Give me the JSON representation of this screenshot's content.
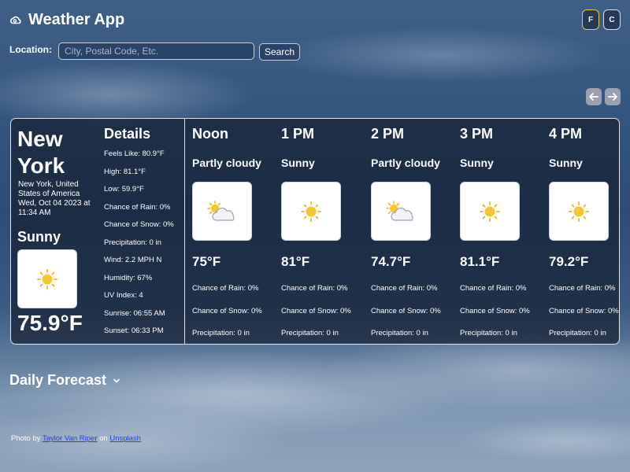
{
  "app": {
    "title": "Weather App"
  },
  "units": {
    "fahrenheit": "F",
    "celsius": "C",
    "selected": "F"
  },
  "search": {
    "label": "Location:",
    "placeholder": "City, Postal Code, Etc.",
    "value": "",
    "button": "Search"
  },
  "current": {
    "city": "New York",
    "location": "New York, United States of America",
    "datetime": "Wed, Oct 04 2023 at 11:34 AM",
    "condition": "Sunny",
    "icon": "sun-icon",
    "temperature": "75.9°F"
  },
  "details": {
    "title": "Details",
    "items": [
      "Feels Like: 80.9°F",
      "High: 81.1°F",
      "Low: 59.9°F",
      "Chance of Rain: 0%",
      "Chance of Snow: 0%",
      "Precipitation: 0 in",
      "Wind: 2.2 MPH N",
      "Humidity: 67%",
      "UV Index: 4",
      "Sunrise: 06:55 AM",
      "Sunset: 06:33 PM"
    ]
  },
  "hourly": [
    {
      "time": "Noon",
      "condition": "Partly cloudy",
      "icon": "partly-cloudy-icon",
      "temp": "75°F",
      "rain": "Chance of Rain: 0%",
      "snow": "Chance of Snow: 0%",
      "precip": "Precipitation: 0 in"
    },
    {
      "time": "1 PM",
      "condition": "Sunny",
      "icon": "sun-icon",
      "temp": "81°F",
      "rain": "Chance of Rain: 0%",
      "snow": "Chance of Snow: 0%",
      "precip": "Precipitation: 0 in"
    },
    {
      "time": "2 PM",
      "condition": "Partly cloudy",
      "icon": "partly-cloudy-icon",
      "temp": "74.7°F",
      "rain": "Chance of Rain: 0%",
      "snow": "Chance of Snow: 0%",
      "precip": "Precipitation: 0 in"
    },
    {
      "time": "3 PM",
      "condition": "Sunny",
      "icon": "sun-icon",
      "temp": "81.1°F",
      "rain": "Chance of Rain: 0%",
      "snow": "Chance of Snow: 0%",
      "precip": "Precipitation: 0 in"
    },
    {
      "time": "4 PM",
      "condition": "Sunny",
      "icon": "sun-icon",
      "temp": "79.2°F",
      "rain": "Chance of Rain: 0%",
      "snow": "Chance of Snow: 0%",
      "precip": "Precipitation: 0 in"
    }
  ],
  "daily": {
    "title": "Daily Forecast"
  },
  "credit": {
    "prefix": "Photo by",
    "author": "Taylor Van Riper",
    "middle": "on",
    "site": "Unsplash"
  }
}
